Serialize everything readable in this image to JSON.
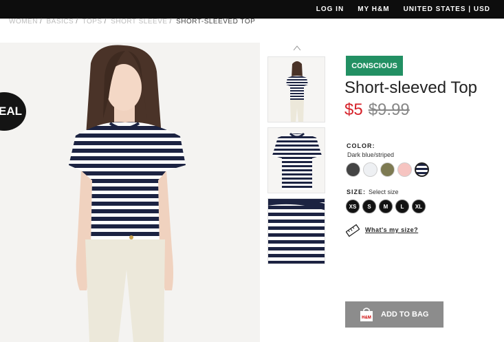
{
  "topbar": {
    "login": "LOG IN",
    "myhm": "MY H&M",
    "region": "UNITED STATES | USD"
  },
  "breadcrumb": {
    "items": [
      "WOMEN",
      "BASICS",
      "TOPS",
      "SHORT SLEEVE"
    ],
    "current": "SHORT-SLEEVED TOP"
  },
  "hero": {
    "deal_label": "EAL"
  },
  "product": {
    "badge": "CONSCIOUS",
    "title": "Short-sleeved Top",
    "price_now": "$5",
    "price_was": "$9.99",
    "color_label": "COLOR:",
    "color_value": "Dark blue/striped",
    "swatches": [
      "#444444",
      "#eef0f3",
      "#7d7a52",
      "#f6c4c1",
      "striped"
    ],
    "size_label": "SIZE:",
    "size_hint": "Select size",
    "sizes": [
      "XS",
      "S",
      "M",
      "L",
      "XL"
    ],
    "size_guide": "What's my size?",
    "add_to_bag": "ADD TO BAG"
  },
  "colors": {
    "badge": "#229063",
    "price": "#d6232b",
    "button": "#8c8c8c",
    "topbar": "#0d0d0d"
  }
}
